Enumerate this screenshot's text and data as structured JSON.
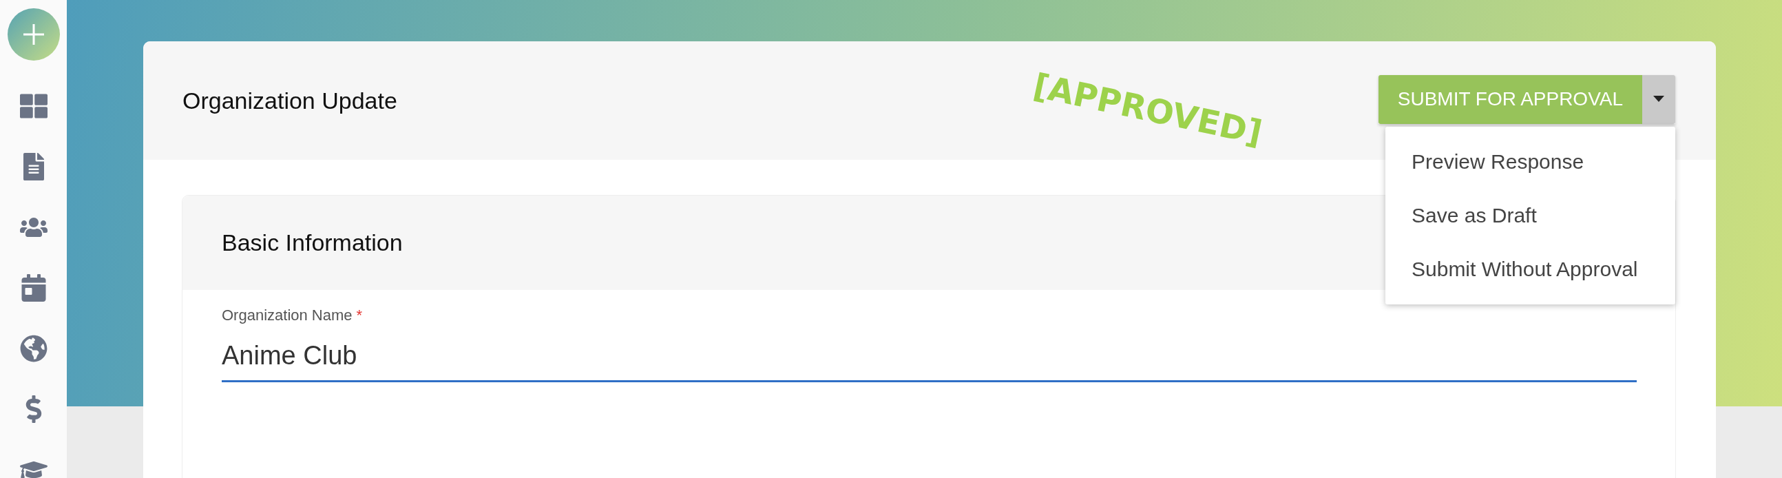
{
  "page": {
    "title": "Organization Update",
    "stamp": "[APPROVED]"
  },
  "submit": {
    "label": "SUBMIT FOR APPROVAL",
    "expanded": true,
    "items": [
      {
        "label": "Preview Response"
      },
      {
        "label": "Save as Draft"
      },
      {
        "label": "Submit Without Approval"
      }
    ]
  },
  "section": {
    "title": "Basic Information",
    "field": {
      "label": "Organization Name",
      "required_mark": "*",
      "value": "Anime Club"
    }
  }
}
